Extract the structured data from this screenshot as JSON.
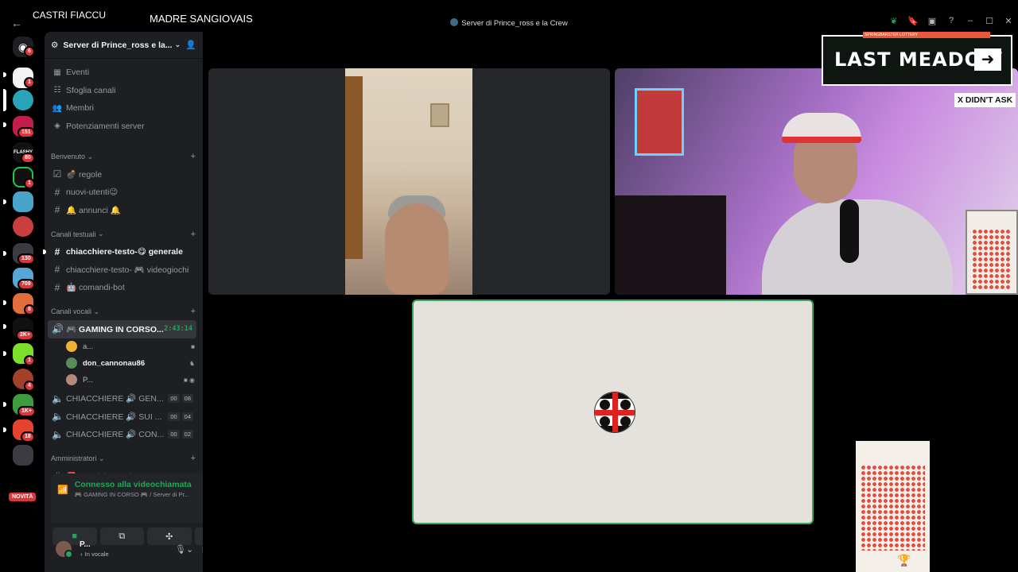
{
  "overlays": {
    "label1": "CASTRI FIACCU",
    "label2": "MADRE SANGIOVAIS"
  },
  "window": {
    "title": "Server di Prince_ross e la Crew"
  },
  "rail": {
    "badges": [
      "6",
      "1",
      "151",
      "80",
      "1",
      "130",
      "709",
      "8",
      "2K+",
      "1",
      "4",
      "1K+",
      "18"
    ],
    "novita": "NOVITÀ"
  },
  "server": {
    "name": "Server di Prince_ross e la...",
    "nav": [
      {
        "icon": "calendar-icon",
        "label": "Eventi"
      },
      {
        "icon": "browse-channels-icon",
        "label": "Sfoglia canali"
      },
      {
        "icon": "members-icon",
        "label": "Membri"
      },
      {
        "icon": "boost-icon",
        "label": "Potenziamenti server"
      }
    ],
    "categories": {
      "benvenuto": "Benvenuto",
      "testuali": "Canali testuali",
      "vocali": "Canali vocali",
      "admin": "Amministratori"
    },
    "benvenuto_channels": [
      "💣 regole",
      "nuovi-utenti😉",
      "🔔 annunci 🔔"
    ],
    "text_channels": [
      "chiacchiere-testo-😋 generale",
      "chiacchiere-testo- 🎮 videogiochi",
      "🤖 comandi-bot"
    ],
    "active_voice": {
      "name": "🎮 GAMING IN CORSO...",
      "timer": "2:43:14"
    },
    "voice_members": [
      "a...",
      "don_cannonau86",
      "P..."
    ],
    "voice_channels": [
      {
        "name": "CHIACCHIERE 🔊 GEN...",
        "a": "00",
        "b": "08"
      },
      {
        "name": "CHIACCHIERE 🔊 SUI ...",
        "a": "00",
        "b": "04"
      },
      {
        "name": "CHIACCHIERE 🔊 CON...",
        "a": "00",
        "b": "02"
      }
    ],
    "admin_channels": [
      "📕 amministratori"
    ]
  },
  "voice_panel": {
    "status": "Connesso alla videochiamata",
    "location": "🎮 GAMING IN CORSO 🎮 / Server di Pr..."
  },
  "user": {
    "name": "P...",
    "status": "In vocale"
  },
  "stream": {
    "game_title": "LAST MEADOW",
    "game_topbar": "SPRINGBARSTER LOTTERY",
    "ask_tag": "X DIDN'T ASK"
  },
  "colors": {
    "accent_green": "#23a55a",
    "badge_red": "#da373c",
    "sidebar_bg": "#1e1f22"
  }
}
